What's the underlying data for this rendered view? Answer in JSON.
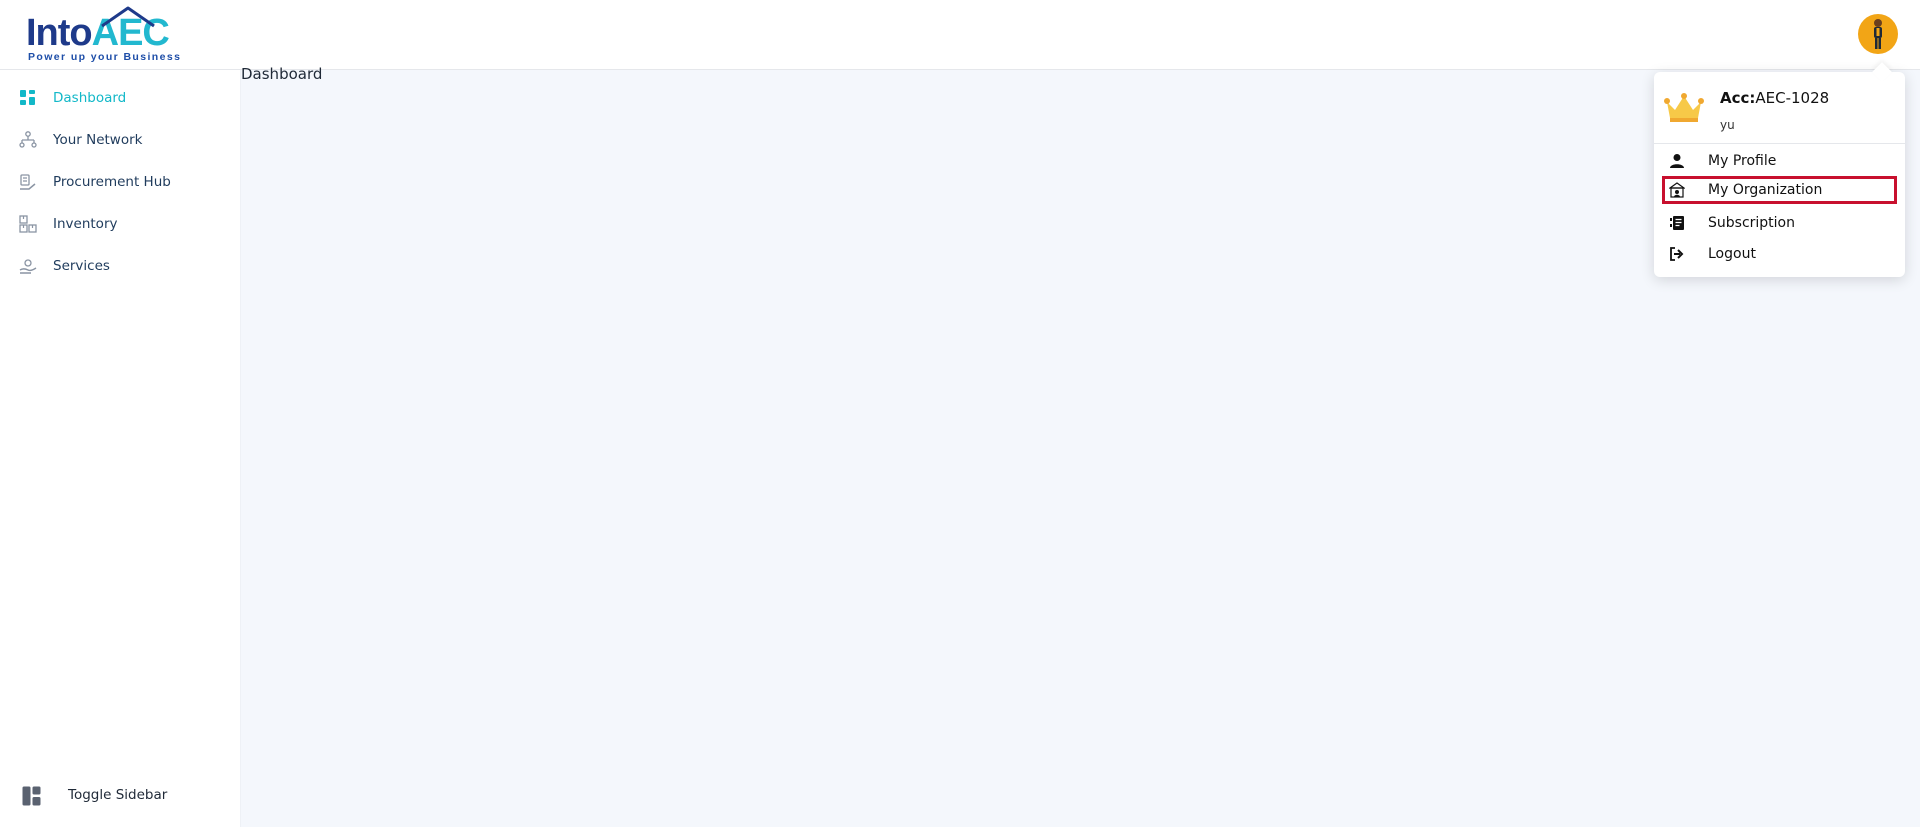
{
  "brand": {
    "name_part1": "Into",
    "name_part2": "AEC",
    "tagline": "Power up your Business",
    "colors": {
      "navy": "#1e3a8a",
      "cyan": "#22b8cf",
      "active": "#12b8c8",
      "highlight": "#c8102e"
    }
  },
  "header": {
    "avatar_icon": "user-avatar-icon"
  },
  "sidebar": {
    "items": [
      {
        "label": "Dashboard",
        "icon": "dashboard-icon",
        "active": true
      },
      {
        "label": "Your Network",
        "icon": "network-icon",
        "active": false
      },
      {
        "label": "Procurement Hub",
        "icon": "procurement-icon",
        "active": false
      },
      {
        "label": "Inventory",
        "icon": "inventory-icon",
        "active": false
      },
      {
        "label": "Services",
        "icon": "services-icon",
        "active": false
      }
    ],
    "toggle_label": "Toggle Sidebar"
  },
  "main": {
    "page_title": "Dashboard"
  },
  "profile_menu": {
    "acc_prefix": "Acc:",
    "acc_id": "AEC-1028",
    "username": "yu",
    "items": [
      {
        "label": "My Profile",
        "icon": "person-icon"
      },
      {
        "label": "My Organization",
        "icon": "organization-icon",
        "highlighted": true
      },
      {
        "label": "Subscription",
        "icon": "subscription-icon"
      },
      {
        "label": "Logout",
        "icon": "logout-icon"
      }
    ]
  }
}
